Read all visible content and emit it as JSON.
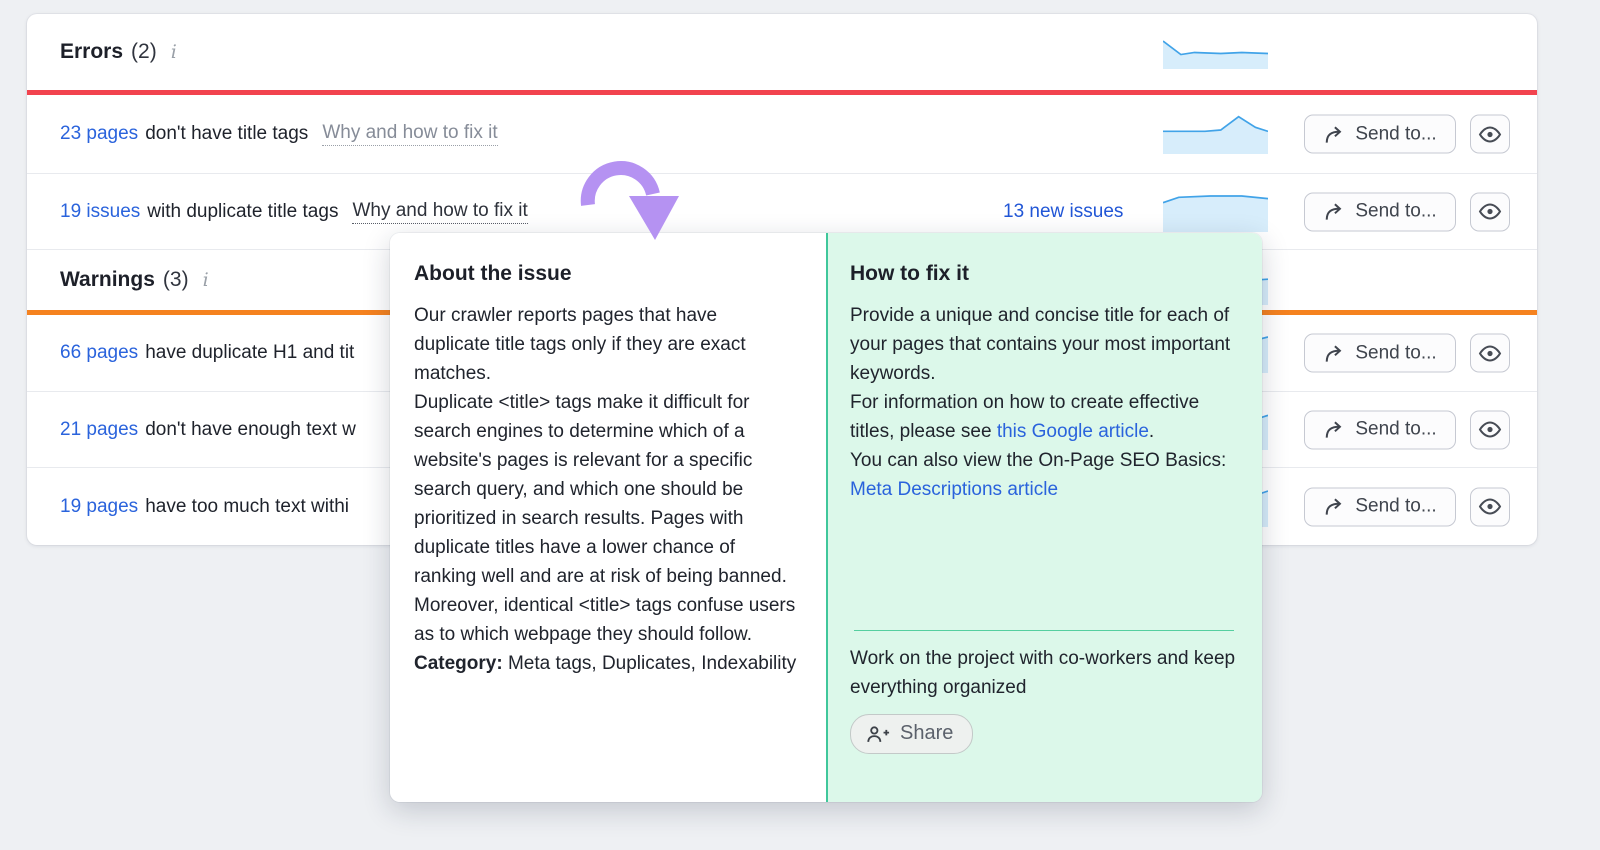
{
  "colors": {
    "error_accent": "#f2434e",
    "warning_accent": "#f5821f",
    "link_blue": "#2a63dc",
    "spark_line": "#41a3e8",
    "spark_fill": "#d7edfb",
    "popup_green_bg": "#dcf8ea",
    "popup_green_divider": "#3fc79b",
    "arrow_purple": "#b592f2"
  },
  "errors_section": {
    "title": "Errors",
    "count": "(2)",
    "rows": [
      {
        "link": "23 pages",
        "text": "don't have title tags",
        "why": "Why and how to fix it"
      },
      {
        "link": "19 issues",
        "text": "with duplicate title tags",
        "why": "Why and how to fix it",
        "new_issues": "13 new issues"
      }
    ]
  },
  "warnings_section": {
    "title": "Warnings",
    "count": "(3)",
    "rows": [
      {
        "link": "66 pages",
        "text": "have duplicate H1 and tit"
      },
      {
        "link": "21 pages",
        "text": "don't have enough text w"
      },
      {
        "link": "19 pages",
        "text": "have too much text withi"
      }
    ]
  },
  "buttons": {
    "send_to": "Send to...",
    "share": "Share"
  },
  "popup": {
    "about": {
      "title": "About the issue",
      "p1": "Our crawler reports pages that have duplicate title tags only if they are exact matches.",
      "p2": "Duplicate <title> tags make it difficult for search engines to determine which of a website's pages is relevant for a specific search query, and which one should be prioritized in search results. Pages with duplicate titles have a lower chance of ranking well and are at risk of being banned.",
      "p3": "Moreover, identical <title> tags confuse users as to which webpage they should follow.",
      "category_label": "Category:",
      "category_value": " Meta tags, Duplicates, Indexability"
    },
    "fix": {
      "title": "How to fix it",
      "p1": "Provide a unique and concise title for each of your pages that contains your most important keywords.",
      "p2_before": "For information on how to create effective titles, please see ",
      "p2_link": "this Google article",
      "p2_after": ".",
      "p3_before": "You can also view the On-Page SEO Basics: ",
      "p3_link": "Meta Descriptions article",
      "share_text": "Work on the project with co-workers and keep everything organized"
    }
  },
  "sparklines": {
    "errors_header": [
      [
        0,
        3
      ],
      [
        17,
        16
      ],
      [
        30,
        14
      ],
      [
        55,
        15
      ],
      [
        75,
        14
      ],
      [
        100,
        15
      ]
    ],
    "row1": [
      [
        0,
        13
      ],
      [
        40,
        13
      ],
      [
        55,
        12
      ],
      [
        72,
        2
      ],
      [
        88,
        10
      ],
      [
        100,
        13
      ]
    ],
    "row2": [
      [
        0,
        8
      ],
      [
        15,
        4
      ],
      [
        45,
        3
      ],
      [
        75,
        3
      ],
      [
        100,
        5
      ]
    ],
    "warnings_header": [
      [
        0,
        12
      ],
      [
        35,
        10
      ],
      [
        70,
        7
      ],
      [
        100,
        5
      ]
    ],
    "row3": [
      [
        0,
        14
      ],
      [
        40,
        12
      ],
      [
        70,
        9
      ],
      [
        100,
        3
      ]
    ],
    "row4": [
      [
        0,
        20
      ],
      [
        50,
        17
      ],
      [
        80,
        9
      ],
      [
        100,
        4
      ]
    ],
    "row5": [
      [
        0,
        22
      ],
      [
        60,
        15
      ],
      [
        85,
        7
      ],
      [
        100,
        3
      ]
    ]
  }
}
